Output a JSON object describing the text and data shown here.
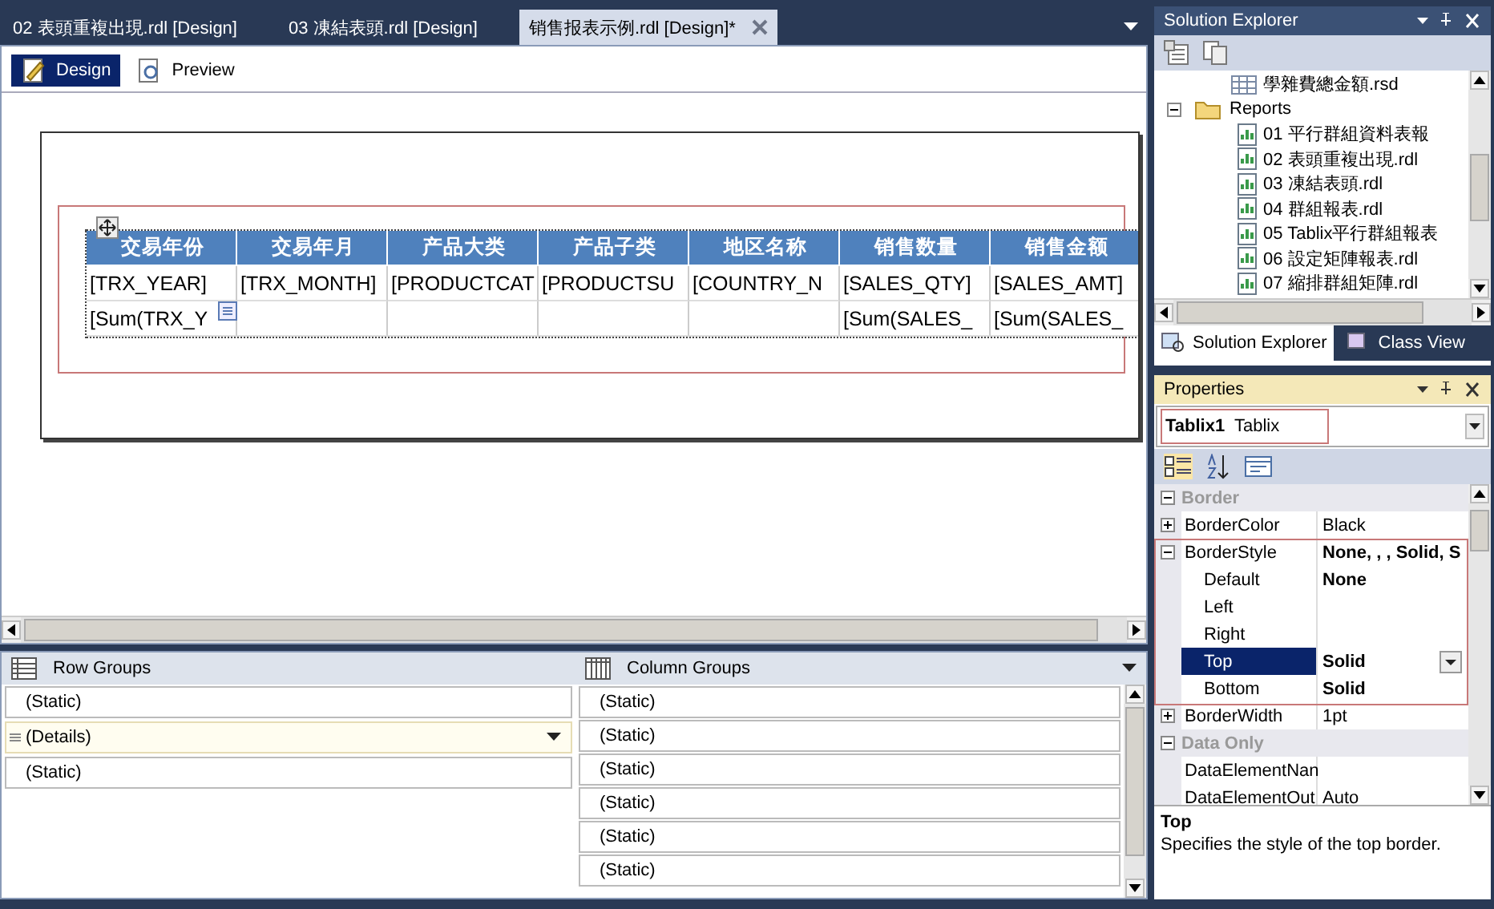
{
  "doc_tabs": [
    {
      "label": "02 表頭重複出現.rdl [Design]",
      "selected": false
    },
    {
      "label": "03 凍結表頭.rdl [Design]",
      "selected": false
    },
    {
      "label": "销售报表示例.rdl [Design]*",
      "selected": true
    }
  ],
  "view_tabs": [
    {
      "label": "Design",
      "selected": true
    },
    {
      "label": "Preview",
      "selected": false
    }
  ],
  "tablix": {
    "columns": [
      "交易年份",
      "交易年月",
      "产品大类",
      "产品子类",
      "地区名称",
      "销售数量",
      "销售金额"
    ],
    "rows": [
      [
        "[TRX_YEAR]",
        "[TRX_MONTH]",
        "[PRODUCTCAT",
        "[PRODUCTSU",
        "[COUNTRY_N",
        "[SALES_QTY]",
        "[SALES_AMT]"
      ],
      [
        "[Sum(TRX_Y",
        "",
        "",
        "",
        "",
        "[Sum(SALES_",
        "[Sum(SALES_"
      ]
    ]
  },
  "row_groups": {
    "title": "Row Groups",
    "items": [
      {
        "label": "(Static)",
        "kind": "static",
        "selected": false
      },
      {
        "label": "(Details)",
        "kind": "details",
        "selected": true
      },
      {
        "label": "(Static)",
        "kind": "static",
        "selected": false
      }
    ]
  },
  "column_groups": {
    "title": "Column Groups",
    "items": [
      "(Static)",
      "(Static)",
      "(Static)",
      "(Static)",
      "(Static)",
      "(Static)"
    ]
  },
  "solution_explorer": {
    "title": "Solution Explorer",
    "tree": [
      {
        "label": "學雜費總金額.rsd",
        "kind": "dataset"
      },
      {
        "label": "Reports",
        "kind": "folder",
        "expanded": true,
        "children": [
          {
            "label": "01 平行群組資料表報",
            "kind": "report"
          },
          {
            "label": "02 表頭重複出現.rdl",
            "kind": "report"
          },
          {
            "label": "03 凍結表頭.rdl",
            "kind": "report"
          },
          {
            "label": "04 群組報表.rdl",
            "kind": "report"
          },
          {
            "label": "05 Tablix平行群組報表",
            "kind": "report"
          },
          {
            "label": "06 設定矩陣報表.rdl",
            "kind": "report"
          },
          {
            "label": "07 縮排群組矩陣.rdl",
            "kind": "report"
          }
        ]
      }
    ],
    "tabs": [
      {
        "label": "Solution Explorer",
        "selected": true
      },
      {
        "label": "Class View",
        "selected": false
      }
    ]
  },
  "properties": {
    "title": "Properties",
    "object_name": "Tablix1",
    "object_type": "Tablix",
    "categories": [
      {
        "name": "Border",
        "expanded": true,
        "items": [
          {
            "name": "BorderColor",
            "value": "Black",
            "bold": false,
            "expanded": false,
            "selected": false
          },
          {
            "name": "BorderStyle",
            "value": "None, , , Solid, S",
            "bold": true,
            "expanded": true,
            "selected": false,
            "children": [
              {
                "name": "Default",
                "value": "None",
                "bold": true,
                "selected": false
              },
              {
                "name": "Left",
                "selected": false
              },
              {
                "name": "Right",
                "selected": false
              },
              {
                "name": "Top",
                "value": "Solid",
                "bold": true,
                "selected": true
              },
              {
                "name": "Bottom",
                "value": "Solid",
                "bold": true,
                "selected": false
              }
            ]
          },
          {
            "name": "BorderWidth",
            "value": "1pt",
            "bold": false,
            "expanded": false,
            "selected": false
          }
        ]
      },
      {
        "name": "Data Only",
        "expanded": true,
        "items": [
          {
            "name": "DataElementNan",
            "selected": false
          },
          {
            "name": "DataElementOut",
            "value": "Auto",
            "bold": false,
            "selected": false
          }
        ]
      }
    ],
    "description": {
      "title": "Top",
      "text": "Specifies the style of the top border."
    }
  }
}
